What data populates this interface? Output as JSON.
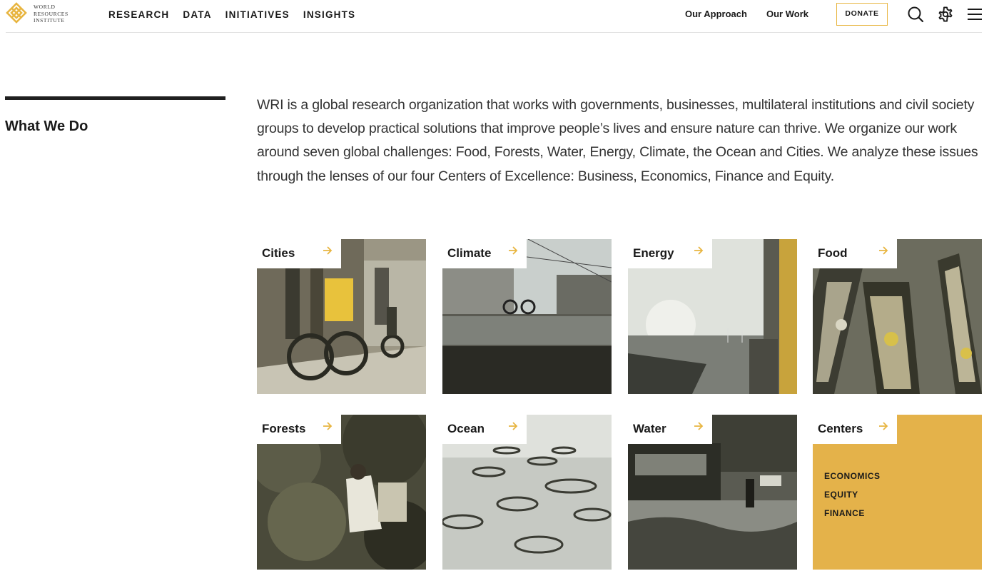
{
  "logo": {
    "lines": [
      "WORLD",
      "RESOURCES",
      "INSTITUTE"
    ],
    "color": "#e8b540"
  },
  "nav": {
    "main": [
      "RESEARCH",
      "DATA",
      "INITIATIVES",
      "INSIGHTS"
    ],
    "our_approach": "Our Approach",
    "our_work": "Our Work",
    "donate": "DONATE",
    "icons": [
      "search-icon",
      "gear-icon",
      "menu-icon"
    ]
  },
  "section": {
    "title": "What We Do",
    "intro": "WRI is a global research organization that works with governments, businesses, multilateral institutions and civil society groups to develop practical solutions that improve people’s lives and ensure nature can thrive. We organize our work around seven global challenges: Food, Forests, Water, Energy, Climate, the Ocean and Cities. We analyze these issues through the lenses of our four Centers of Excellence: Business, Economics, Finance and Equity."
  },
  "tiles": [
    {
      "label": "Cities"
    },
    {
      "label": "Climate"
    },
    {
      "label": "Energy"
    },
    {
      "label": "Food"
    },
    {
      "label": "Forests"
    },
    {
      "label": "Ocean"
    },
    {
      "label": "Water"
    },
    {
      "label": "Centers",
      "links": [
        "ECONOMICS",
        "EQUITY",
        "FINANCE"
      ]
    }
  ],
  "colors": {
    "accent": "#e8b540",
    "centers_bg": "#e4b24a",
    "text": "#1a1a1a"
  }
}
